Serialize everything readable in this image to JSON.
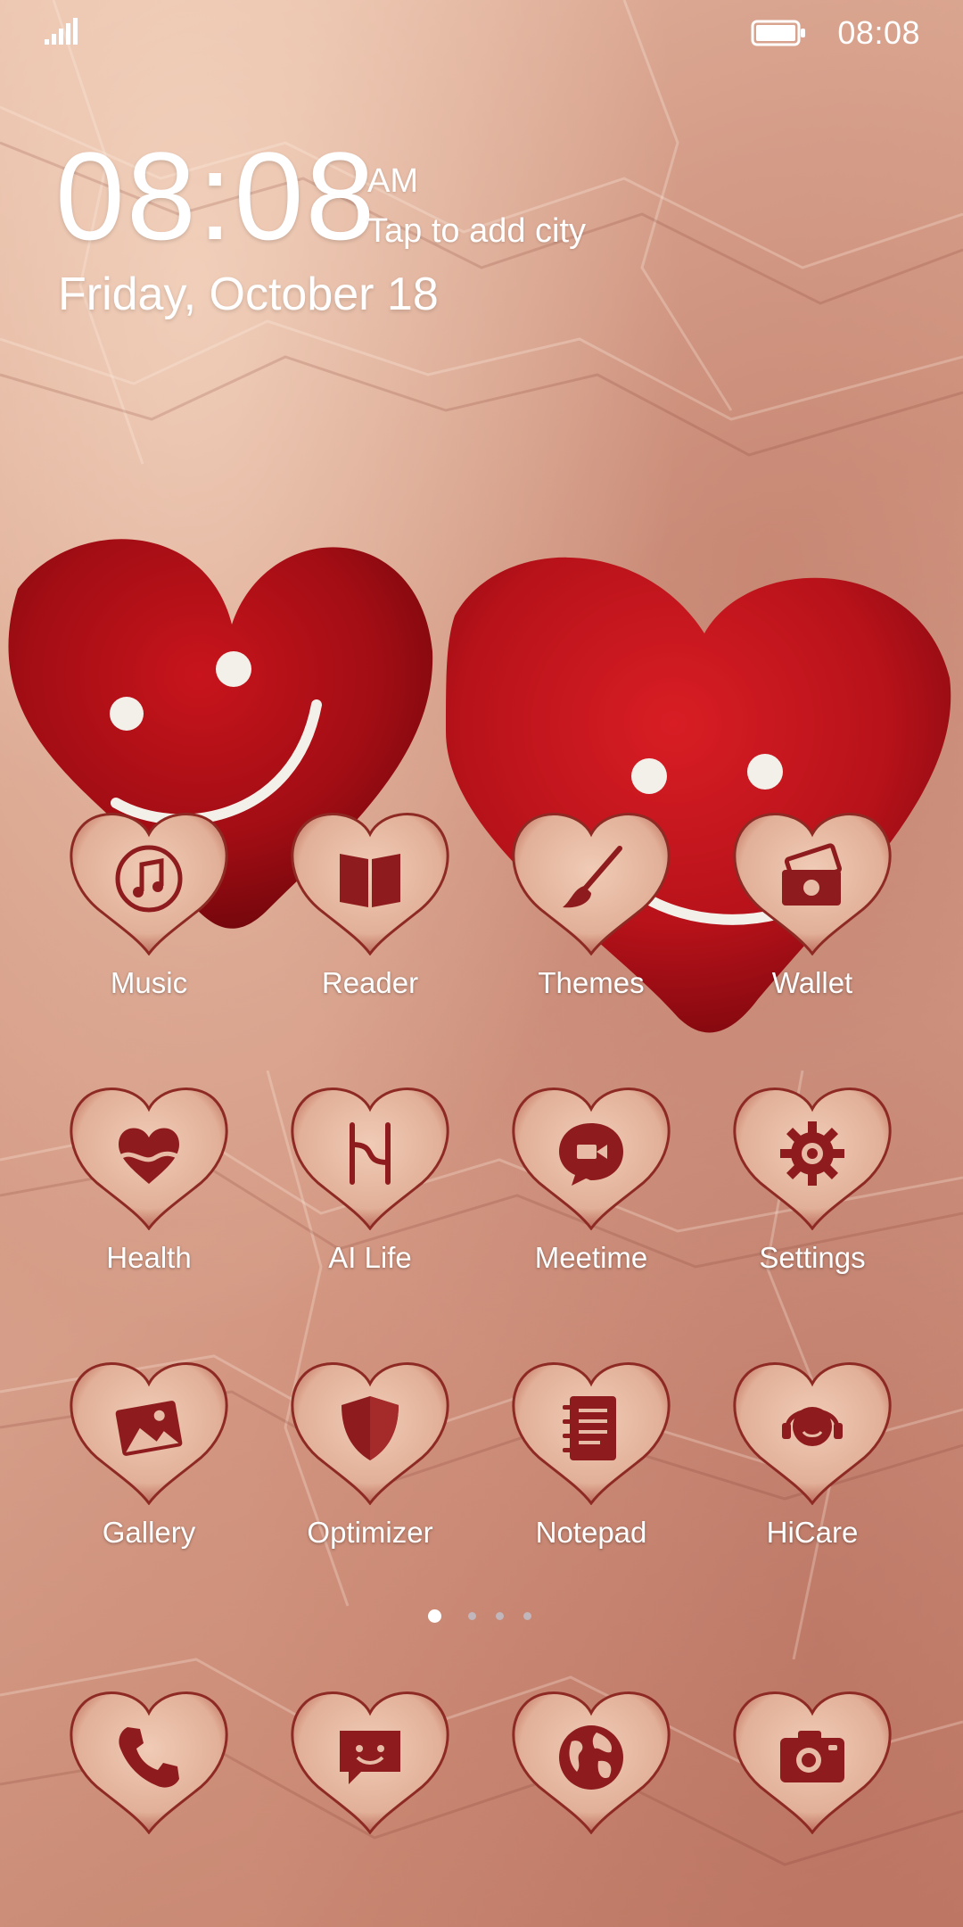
{
  "status_bar": {
    "time": "08:08",
    "signal_icon": "signal-icon",
    "battery_icon": "battery-icon"
  },
  "clock": {
    "time": "08:08",
    "ampm": "AM",
    "city": "Tap to add city",
    "date": "Friday, October 18"
  },
  "apps": [
    {
      "label": "Music",
      "icon": "music-note-icon"
    },
    {
      "label": "Reader",
      "icon": "book-icon"
    },
    {
      "label": "Themes",
      "icon": "paintbrush-icon"
    },
    {
      "label": "Wallet",
      "icon": "wallet-icon"
    },
    {
      "label": "Health",
      "icon": "heart-pulse-icon"
    },
    {
      "label": "AI Life",
      "icon": "ai-life-icon"
    },
    {
      "label": "Meetime",
      "icon": "video-chat-icon"
    },
    {
      "label": "Settings",
      "icon": "gear-icon"
    },
    {
      "label": "Gallery",
      "icon": "image-icon"
    },
    {
      "label": "Optimizer",
      "icon": "shield-icon"
    },
    {
      "label": "Notepad",
      "icon": "notepad-icon"
    },
    {
      "label": "HiCare",
      "icon": "headset-icon"
    }
  ],
  "page_indicator": {
    "pages": 4,
    "active": 1
  },
  "dock": [
    {
      "icon": "phone-icon"
    },
    {
      "icon": "message-icon"
    },
    {
      "icon": "globe-icon"
    },
    {
      "icon": "camera-icon"
    }
  ],
  "colors": {
    "icon_fill": "#8e1c1e",
    "heart_fill": "#e7bba5",
    "heart_edge": "#a3443b"
  }
}
